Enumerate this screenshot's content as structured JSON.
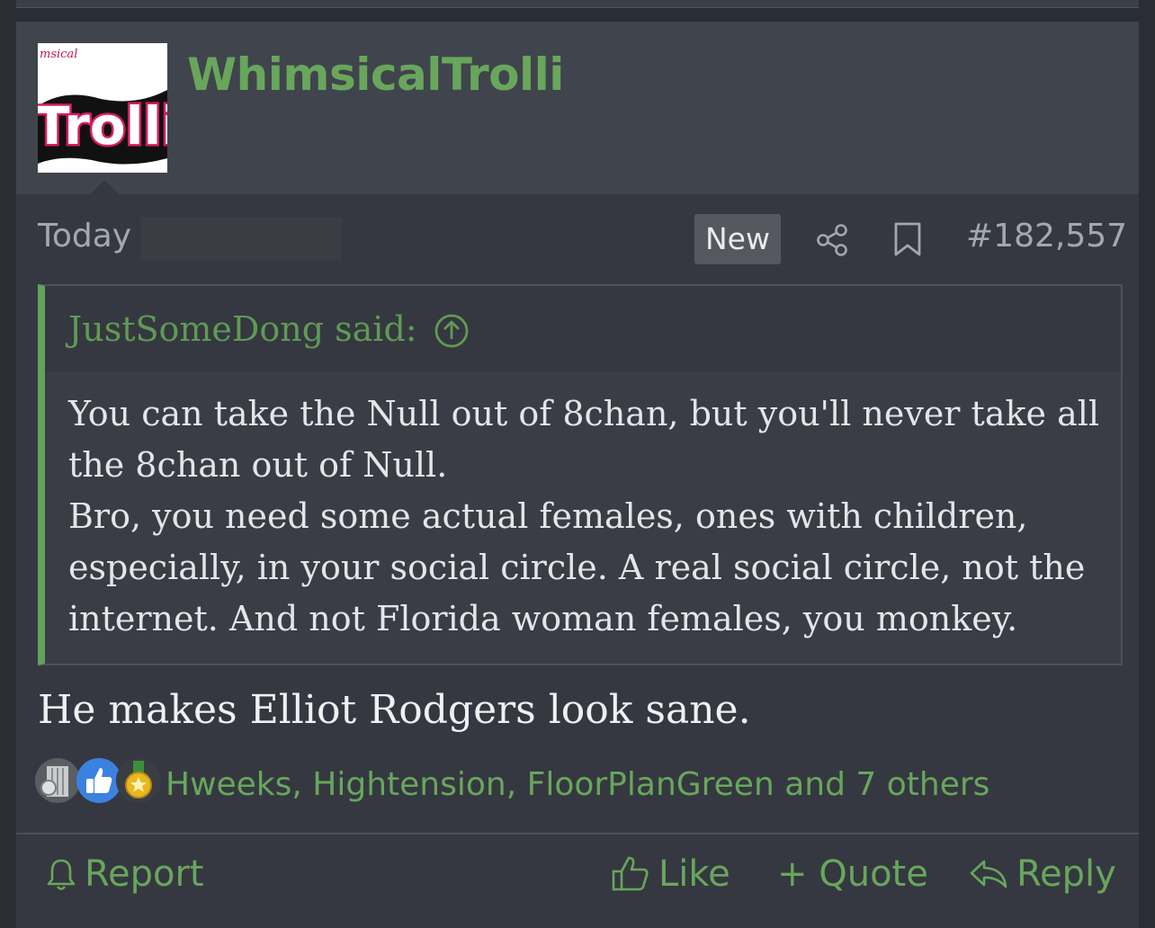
{
  "post": {
    "author": "WhimsicalTrolli",
    "avatar_text": "Trolli",
    "avatar_subtext": "msical",
    "date": "Today",
    "new_badge": "New",
    "post_number": "#182,557",
    "share_icon": "share-icon",
    "bookmark_icon": "bookmark-icon"
  },
  "quote": {
    "author_said": "JustSomeDong said:",
    "jump_icon": "arrow-up-circle-icon",
    "lines": [
      "You can take the Null out of 8chan, but you'll never take all",
      "the 8chan out of Null.",
      "Bro, you need some actual females, ones with children,",
      "especially, in your social circle. A real social circle, not the",
      "internet. And not Florida woman females, you monkey."
    ]
  },
  "message": "He makes Elliot Rodgers look sane.",
  "reactions": {
    "icons": [
      "column-icon",
      "thumbs-up-icon",
      "medal-icon"
    ],
    "people": "Hweeks, Hightension, FloorPlanGreen and 7 others"
  },
  "actions": {
    "report": "Report",
    "like": "Like",
    "quote": "+ Quote",
    "reply": "Reply"
  },
  "colors": {
    "accent": "#68a65c",
    "quote_border": "#5fa45a",
    "background": "#353840",
    "header_background": "#40444c"
  }
}
